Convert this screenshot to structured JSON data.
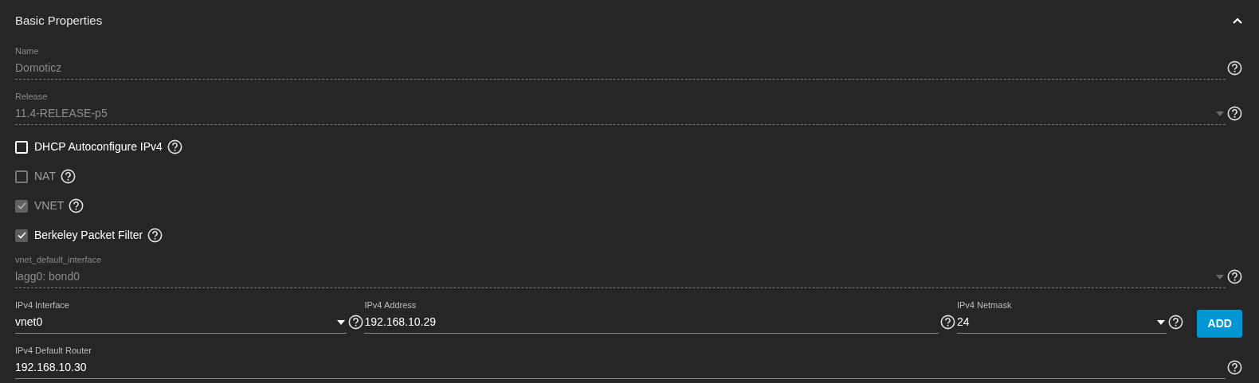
{
  "section": {
    "title": "Basic Properties",
    "expanded": true
  },
  "items": [
    {
      "kind": "text",
      "label": "Name",
      "value": "Domoticz",
      "disabled": true
    },
    {
      "kind": "select",
      "label": "Release",
      "value": "11.4-RELEASE-p5",
      "disabled": true
    },
    {
      "kind": "checkbox",
      "label": "DHCP Autoconfigure IPv4",
      "checked": false,
      "disabled": false
    },
    {
      "kind": "checkbox",
      "label": "NAT",
      "checked": false,
      "disabled": true
    },
    {
      "kind": "checkbox",
      "label": "VNET",
      "checked": true,
      "disabled": true
    },
    {
      "kind": "checkbox",
      "label": "Berkeley Packet Filter",
      "checked": true,
      "disabled": false
    },
    {
      "kind": "select",
      "label": "vnet_default_interface",
      "value": "lagg0: bond0",
      "disabled": true
    },
    {
      "kind": "group",
      "button": "ADD",
      "fields": [
        {
          "kind": "select",
          "label": "IPv4 Interface",
          "value": "vnet0",
          "disabled": false
        },
        {
          "kind": "text",
          "label": "IPv4 Address",
          "value": "192.168.10.29",
          "disabled": false
        },
        {
          "kind": "select",
          "label": "IPv4 Netmask",
          "value": "24",
          "disabled": false
        }
      ]
    },
    {
      "kind": "text",
      "label": "IPv4 Default Router",
      "value": "192.168.10.30",
      "disabled": false
    }
  ]
}
